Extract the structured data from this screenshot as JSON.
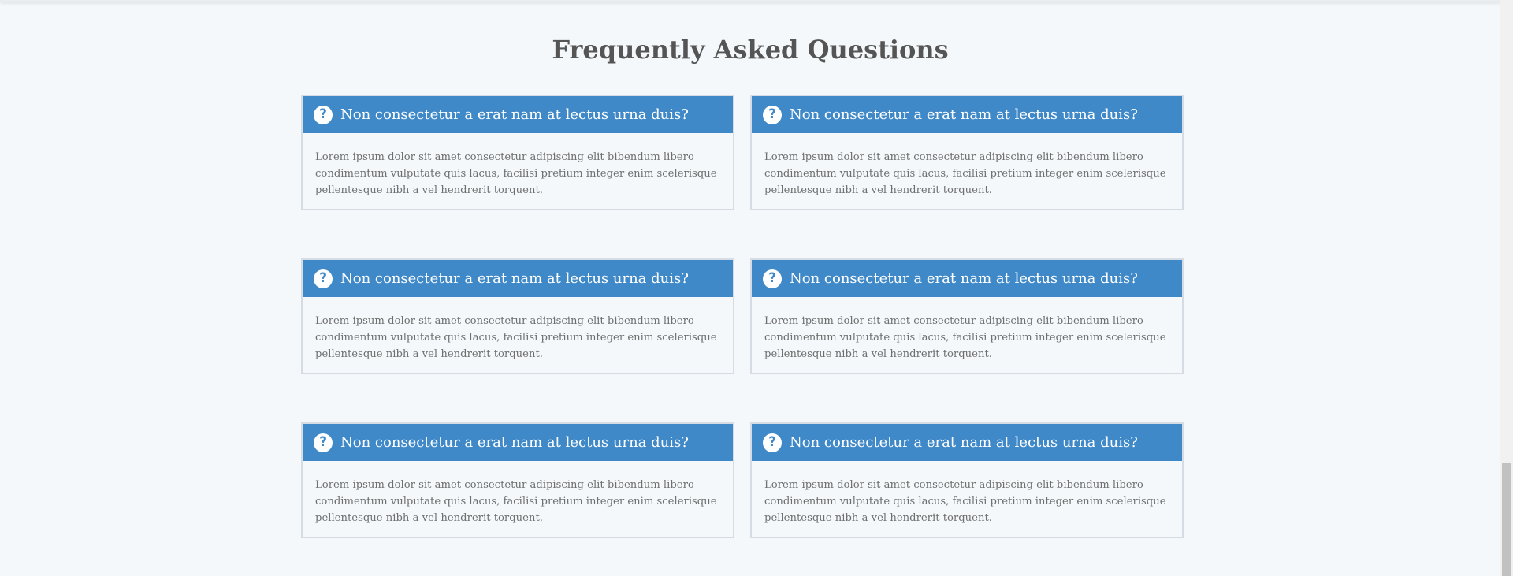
{
  "faq": {
    "title": "Frequently Asked Questions",
    "items": [
      {
        "question": "Non consectetur a erat nam at lectus urna duis?",
        "answer": "Lorem ipsum dolor sit amet consectetur adipiscing elit bibendum libero condimentum vulputate quis lacus, facilisi pretium integer enim scelerisque pellentesque nibh a vel hendrerit torquent."
      },
      {
        "question": "Non consectetur a erat nam at lectus urna duis?",
        "answer": "Lorem ipsum dolor sit amet consectetur adipiscing elit bibendum libero condimentum vulputate quis lacus, facilisi pretium integer enim scelerisque pellentesque nibh a vel hendrerit torquent."
      },
      {
        "question": "Non consectetur a erat nam at lectus urna duis?",
        "answer": "Lorem ipsum dolor sit amet consectetur adipiscing elit bibendum libero condimentum vulputate quis lacus, facilisi pretium integer enim scelerisque pellentesque nibh a vel hendrerit torquent."
      },
      {
        "question": "Non consectetur a erat nam at lectus urna duis?",
        "answer": "Lorem ipsum dolor sit amet consectetur adipiscing elit bibendum libero condimentum vulputate quis lacus, facilisi pretium integer enim scelerisque pellentesque nibh a vel hendrerit torquent."
      },
      {
        "question": "Non consectetur a erat nam at lectus urna duis?",
        "answer": "Lorem ipsum dolor sit amet consectetur adipiscing elit bibendum libero condimentum vulputate quis lacus, facilisi pretium integer enim scelerisque pellentesque nibh a vel hendrerit torquent."
      },
      {
        "question": "Non consectetur a erat nam at lectus urna duis?",
        "answer": "Lorem ipsum dolor sit amet consectetur adipiscing elit bibendum libero condimentum vulputate quis lacus, facilisi pretium integer enim scelerisque pellentesque nibh a vel hendrerit torquent."
      }
    ]
  },
  "icons": {
    "question": "question-circle-icon",
    "question_glyph": "?"
  },
  "colors": {
    "accent": "#3f89c9",
    "background": "#f4f8fb",
    "card_border": "#d5dce3",
    "title_text": "#555555",
    "body_text": "#6f6f6f"
  }
}
